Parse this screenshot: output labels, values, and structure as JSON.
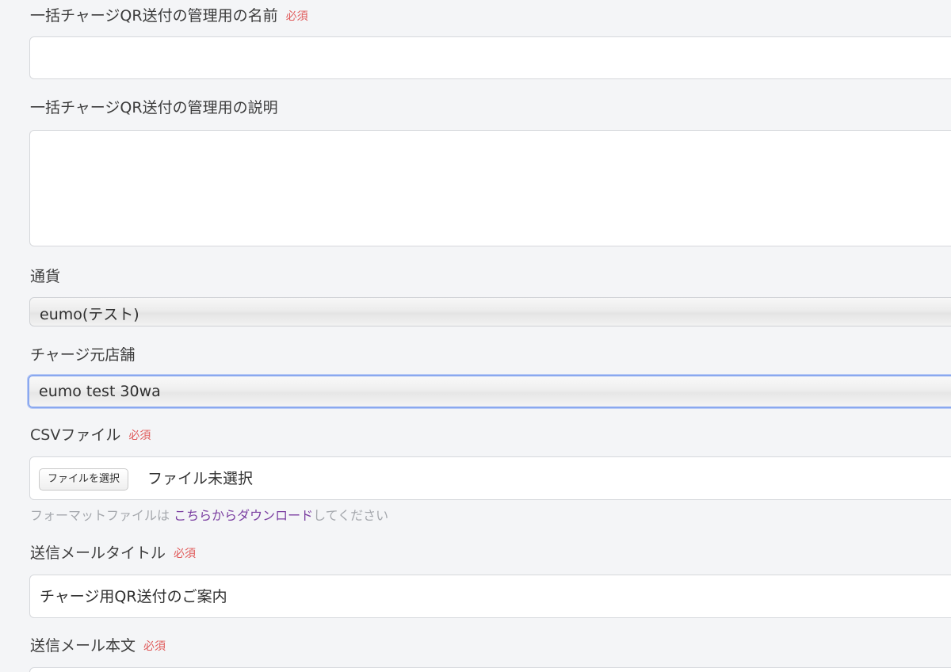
{
  "required_badge": "必須",
  "fields": {
    "name": {
      "label": "一括チャージQR送付の管理用の名前",
      "value": ""
    },
    "description": {
      "label": "一括チャージQR送付の管理用の説明",
      "value": ""
    },
    "currency": {
      "label": "通貨",
      "value": "eumo(テスト)"
    },
    "source_store": {
      "label": "チャージ元店舗",
      "value": "eumo test 30wa"
    },
    "csv_file": {
      "label": "CSVファイル",
      "button_label": "ファイルを選択",
      "status": "ファイル未選択",
      "help_prefix": "フォーマットファイルは ",
      "help_link": "こちらからダウンロード",
      "help_suffix": "してください"
    },
    "mail_title": {
      "label": "送信メールタイトル",
      "value": "チャージ用QR送付のご案内"
    },
    "mail_body": {
      "label": "送信メール本文"
    }
  }
}
